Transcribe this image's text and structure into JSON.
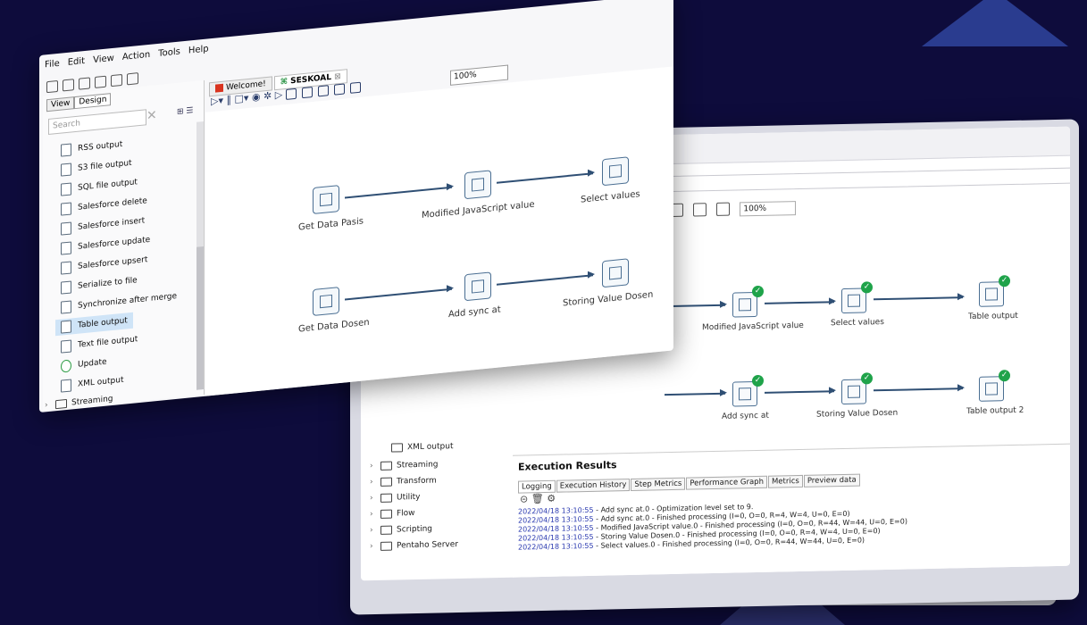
{
  "front_window": {
    "menu": [
      "File",
      "Edit",
      "View",
      "Action",
      "Tools",
      "Help"
    ],
    "side_tabs": [
      "View",
      "Design"
    ],
    "search_placeholder": "Search",
    "steps": [
      "RSS output",
      "S3 file output",
      "SQL file output",
      "Salesforce delete",
      "Salesforce insert",
      "Salesforce update",
      "Salesforce upsert",
      "Serialize to file",
      "Synchronize after merge",
      "Table output",
      "Text file output",
      "Update",
      "XML output"
    ],
    "selected_step": "Table output",
    "folder_streaming": "Streaming",
    "tabs": {
      "welcome": "Welcome!",
      "transformation": "SESKOAL"
    },
    "zoom": "100%",
    "nodes": {
      "get_data_pasis": "Get Data Pasis",
      "modified_js": "Modified JavaScript value",
      "select_values": "Select values",
      "get_data_dosen": "Get Data Dosen",
      "add_sync_at": "Add sync at",
      "storing_value_dosen": "Storing Value Dosen"
    }
  },
  "monitor": {
    "zoom": "100%",
    "nodes": {
      "modified_js": "Modified JavaScript value",
      "select_values": "Select values",
      "table_output": "Table output",
      "add_sync_at": "Add sync at",
      "storing_value_dosen": "Storing Value Dosen",
      "table_output_2": "Table output 2"
    },
    "tree": [
      "XML output",
      "Streaming",
      "Transform",
      "Utility",
      "Flow",
      "Scripting",
      "Pentaho Server"
    ],
    "exec_title": "Execution Results",
    "exec_tabs": [
      "Logging",
      "Execution History",
      "Step Metrics",
      "Performance Graph",
      "Metrics",
      "Preview data"
    ],
    "log": [
      {
        "ts": "2022/04/18 13:10:55",
        "msg": " - Add sync at.0 - Optimization level set to 9."
      },
      {
        "ts": "2022/04/18 13:10:55",
        "msg": " - Add sync at.0 - Finished processing (I=0, O=0, R=4, W=4, U=0, E=0)"
      },
      {
        "ts": "2022/04/18 13:10:55",
        "msg": " - Modified JavaScript value.0 - Finished processing (I=0, O=0, R=44, W=44, U=0, E=0)"
      },
      {
        "ts": "2022/04/18 13:10:55",
        "msg": " - Storing Value Dosen.0 - Finished processing (I=0, O=0, R=4, W=4, U=0, E=0)"
      },
      {
        "ts": "2022/04/18 13:10:55",
        "msg": " - Select values.0 - Finished processing (I=0, O=0, R=44, W=44, U=0, E=0)"
      }
    ]
  }
}
